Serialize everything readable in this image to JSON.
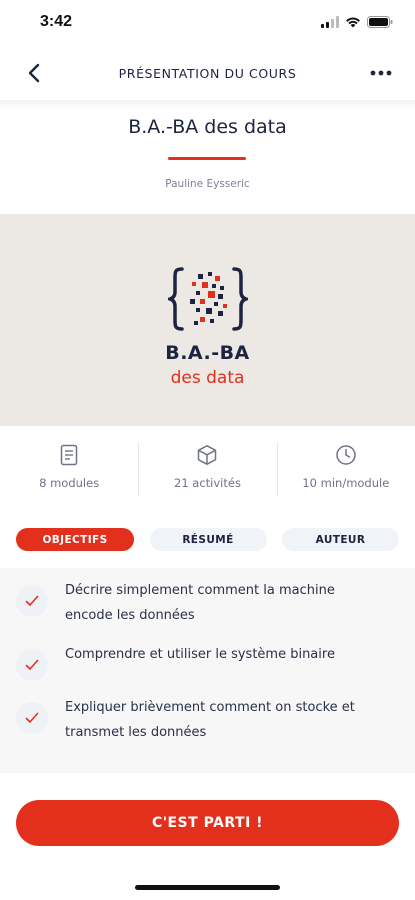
{
  "status_bar": {
    "time": "3:42"
  },
  "nav": {
    "title": "PRÉSENTATION DU COURS"
  },
  "course": {
    "title": "B.A.-BA des data",
    "author": "Pauline Eysseric"
  },
  "banner": {
    "logo_line1": "B.A.-BA",
    "logo_line2": "des data"
  },
  "stats": [
    {
      "icon": "document-icon",
      "label": "8 modules"
    },
    {
      "icon": "cube-icon",
      "label": "21 activités"
    },
    {
      "icon": "clock-icon",
      "label": "10 min/module"
    }
  ],
  "tabs": [
    {
      "label": "OBJECTIFS",
      "active": true
    },
    {
      "label": "RÉSUMÉ",
      "active": false
    },
    {
      "label": "AUTEUR",
      "active": false
    }
  ],
  "objectives": [
    {
      "text_line1": "Décrire simplement comment la machine",
      "text_line2": "encode les données"
    },
    {
      "text_line1": "Comprendre et utiliser le système binaire",
      "text_line2": ""
    },
    {
      "text_line1": "Expliquer brièvement comment on stocke et",
      "text_line2": "transmet les données"
    }
  ],
  "cta": {
    "label": "C'EST PARTI !"
  },
  "colors": {
    "accent": "#e3301c",
    "navy": "#1d2340",
    "banner_bg": "#ece8e3"
  }
}
